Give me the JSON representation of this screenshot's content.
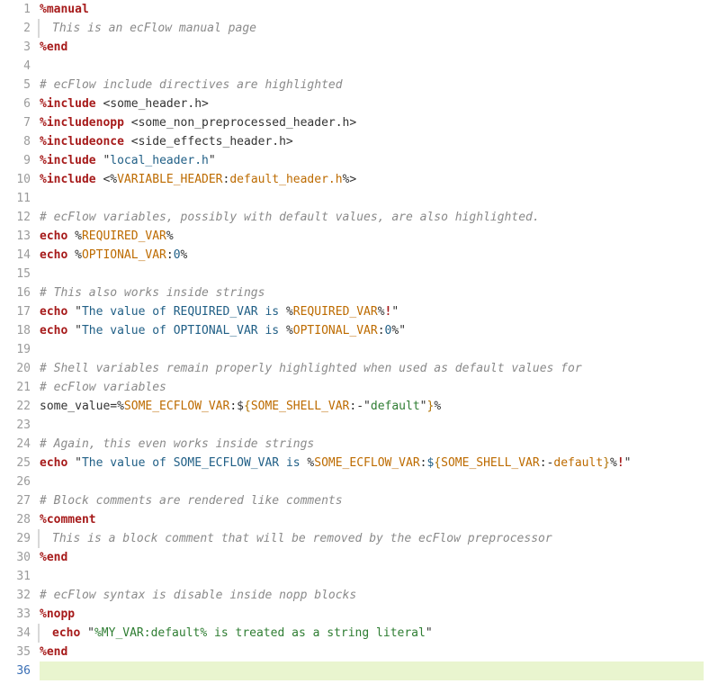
{
  "line_count": 36,
  "current_line": 36,
  "lines": {
    "1": {
      "segs": [
        [
          "directive",
          "%manual"
        ]
      ]
    },
    "2": {
      "indent": true,
      "segs": [
        [
          "comment-it",
          "This is an ecFlow manual page"
        ]
      ]
    },
    "3": {
      "segs": [
        [
          "directive",
          "%end"
        ]
      ]
    },
    "4": {
      "segs": []
    },
    "5": {
      "segs": [
        [
          "comment",
          "# ecFlow include directives are highlighted"
        ]
      ]
    },
    "6": {
      "segs": [
        [
          "directive",
          "%include"
        ],
        [
          "plain",
          " <some_header.h>"
        ]
      ]
    },
    "7": {
      "segs": [
        [
          "directive",
          "%includenopp"
        ],
        [
          "plain",
          " <some_non_preprocessed_header.h>"
        ]
      ]
    },
    "8": {
      "segs": [
        [
          "directive",
          "%includeonce"
        ],
        [
          "plain",
          " <side_effects_header.h>"
        ]
      ]
    },
    "9": {
      "segs": [
        [
          "directive",
          "%include"
        ],
        [
          "plain",
          " "
        ],
        [
          "string-quote",
          "\""
        ],
        [
          "string",
          "local_header.h"
        ],
        [
          "string-quote",
          "\""
        ]
      ]
    },
    "10": {
      "segs": [
        [
          "directive",
          "%include"
        ],
        [
          "plain",
          " <"
        ],
        [
          "punct",
          "%"
        ],
        [
          "var",
          "VARIABLE_HEADER"
        ],
        [
          "punct",
          ":"
        ],
        [
          "default",
          "default_header.h"
        ],
        [
          "punct",
          "%"
        ],
        [
          "plain",
          ">"
        ]
      ]
    },
    "11": {
      "segs": []
    },
    "12": {
      "segs": [
        [
          "comment",
          "# ecFlow variables, possibly with default values, are also highlighted."
        ]
      ]
    },
    "13": {
      "segs": [
        [
          "keyword",
          "echo"
        ],
        [
          "plain",
          " %"
        ],
        [
          "var",
          "REQUIRED_VAR"
        ],
        [
          "plain",
          "%"
        ]
      ]
    },
    "14": {
      "segs": [
        [
          "keyword",
          "echo"
        ],
        [
          "plain",
          " %"
        ],
        [
          "var",
          "OPTIONAL_VAR"
        ],
        [
          "punct",
          ":"
        ],
        [
          "number",
          "0"
        ],
        [
          "plain",
          "%"
        ]
      ]
    },
    "15": {
      "segs": []
    },
    "16": {
      "segs": [
        [
          "comment",
          "# This also works inside strings"
        ]
      ]
    },
    "17": {
      "segs": [
        [
          "keyword",
          "echo"
        ],
        [
          "plain",
          " "
        ],
        [
          "string-quote",
          "\""
        ],
        [
          "string",
          "The value of REQUIRED_VAR is "
        ],
        [
          "punct",
          "%"
        ],
        [
          "var",
          "REQUIRED_VAR"
        ],
        [
          "punct",
          "%"
        ],
        [
          "bang",
          "!"
        ],
        [
          "string-quote",
          "\""
        ]
      ]
    },
    "18": {
      "segs": [
        [
          "keyword",
          "echo"
        ],
        [
          "plain",
          " "
        ],
        [
          "string-quote",
          "\""
        ],
        [
          "string",
          "The value of OPTIONAL_VAR is "
        ],
        [
          "punct",
          "%"
        ],
        [
          "var",
          "OPTIONAL_VAR"
        ],
        [
          "punct",
          ":"
        ],
        [
          "number",
          "0"
        ],
        [
          "punct",
          "%"
        ],
        [
          "string-quote",
          "\""
        ]
      ]
    },
    "19": {
      "segs": []
    },
    "20": {
      "segs": [
        [
          "comment",
          "# Shell variables remain properly highlighted when used as default values for"
        ]
      ]
    },
    "21": {
      "segs": [
        [
          "comment",
          "# ecFlow variables"
        ]
      ]
    },
    "22": {
      "segs": [
        [
          "plain",
          "some_value="
        ],
        [
          "punct",
          "%"
        ],
        [
          "var",
          "SOME_ECFLOW_VAR"
        ],
        [
          "punct",
          ":"
        ],
        [
          "plain",
          "$"
        ],
        [
          "brace",
          "{"
        ],
        [
          "var",
          "SOME_SHELL_VAR"
        ],
        [
          "punct",
          ":-"
        ],
        [
          "string-quote",
          "\""
        ],
        [
          "str-green",
          "default"
        ],
        [
          "string-quote",
          "\""
        ],
        [
          "brace",
          "}"
        ],
        [
          "punct",
          "%"
        ]
      ]
    },
    "23": {
      "segs": []
    },
    "24": {
      "segs": [
        [
          "comment",
          "# Again, this even works inside strings"
        ]
      ]
    },
    "25": {
      "segs": [
        [
          "keyword",
          "echo"
        ],
        [
          "plain",
          " "
        ],
        [
          "string-quote",
          "\""
        ],
        [
          "string",
          "The value of SOME_ECFLOW_VAR is "
        ],
        [
          "punct",
          "%"
        ],
        [
          "var",
          "SOME_ECFLOW_VAR"
        ],
        [
          "punct",
          ":"
        ],
        [
          "string",
          "$"
        ],
        [
          "brace",
          "{"
        ],
        [
          "var",
          "SOME_SHELL_VAR"
        ],
        [
          "punct",
          ":-"
        ],
        [
          "default",
          "default"
        ],
        [
          "brace",
          "}"
        ],
        [
          "punct",
          "%"
        ],
        [
          "bang",
          "!"
        ],
        [
          "string-quote",
          "\""
        ]
      ]
    },
    "26": {
      "segs": []
    },
    "27": {
      "segs": [
        [
          "comment",
          "# Block comments are rendered like comments"
        ]
      ]
    },
    "28": {
      "segs": [
        [
          "directive",
          "%comment"
        ]
      ]
    },
    "29": {
      "indent": true,
      "segs": [
        [
          "comment-it",
          "This is a block comment that will be removed by the ecFlow preprocessor"
        ]
      ]
    },
    "30": {
      "segs": [
        [
          "directive",
          "%end"
        ]
      ]
    },
    "31": {
      "segs": []
    },
    "32": {
      "segs": [
        [
          "comment",
          "# ecFlow syntax is disable inside nopp blocks"
        ]
      ]
    },
    "33": {
      "segs": [
        [
          "directive",
          "%nopp"
        ]
      ]
    },
    "34": {
      "indent": true,
      "segs": [
        [
          "keyword",
          "echo"
        ],
        [
          "plain",
          " "
        ],
        [
          "string-quote",
          "\""
        ],
        [
          "str-green",
          "%MY_VAR:default% is treated as a string literal"
        ],
        [
          "string-quote",
          "\""
        ]
      ]
    },
    "35": {
      "segs": [
        [
          "directive",
          "%end"
        ]
      ]
    },
    "36": {
      "highlight": true,
      "segs": []
    }
  },
  "token_classes": {
    "directive": "c-directive",
    "keyword": "c-keyword",
    "comment": "c-comment",
    "comment-it": "c-comment-it",
    "plain": "c-plain",
    "string": "c-string",
    "string-quote": "c-string-quote",
    "var": "c-var",
    "default": "c-default",
    "number": "c-number",
    "punct": "c-punct",
    "delim": "c-delim",
    "bang": "c-bang",
    "brace": "c-brace",
    "str-green": "c-str-green"
  }
}
